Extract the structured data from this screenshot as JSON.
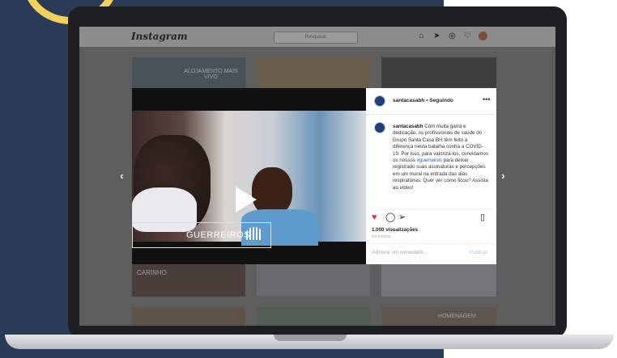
{
  "app": {
    "logo_text": "Instagram"
  },
  "nav": {
    "search_placeholder": "Pesquisar",
    "icons": [
      "home-icon",
      "direct-icon",
      "explore-icon",
      "heart-icon",
      "avatar"
    ]
  },
  "grid": {
    "tile1_caption": "ALOJAMENTO MAIS VIVO",
    "tile2_caption": "CARINHO",
    "tile3_caption": "HOMENAGEM"
  },
  "video": {
    "label": "GUERREIROS"
  },
  "post": {
    "username": "santacasabh",
    "separator": " • ",
    "following": "Seguindo",
    "more_label": "•••",
    "caption_user": "santacasabh",
    "caption_text_1": "Com muita garra e dedicação, os profissionais de saúde do Grupo Santa Casa BH têm feito a diferença nesta batalha contra a COVID-19. Por isso, para valorizá-los, convidamos os nossos",
    "hashtag": "#guerreiros",
    "caption_text_2": "para deixar registrado suas assinaturas e percepções em um mural na entrada das alas respiratórias. Quer ver como ficou? Assista ao vídeo!",
    "views": "1.000 visualizações",
    "time": "HÁ 3 DIAS",
    "comment_placeholder": "Adicione um comentário...",
    "publish_label": "Publicar"
  },
  "colors": {
    "brand_navy": "#2a3b55",
    "accent_yellow": "#f2d25a",
    "like_red": "#e0304a",
    "link_blue": "#1b5fa8"
  }
}
